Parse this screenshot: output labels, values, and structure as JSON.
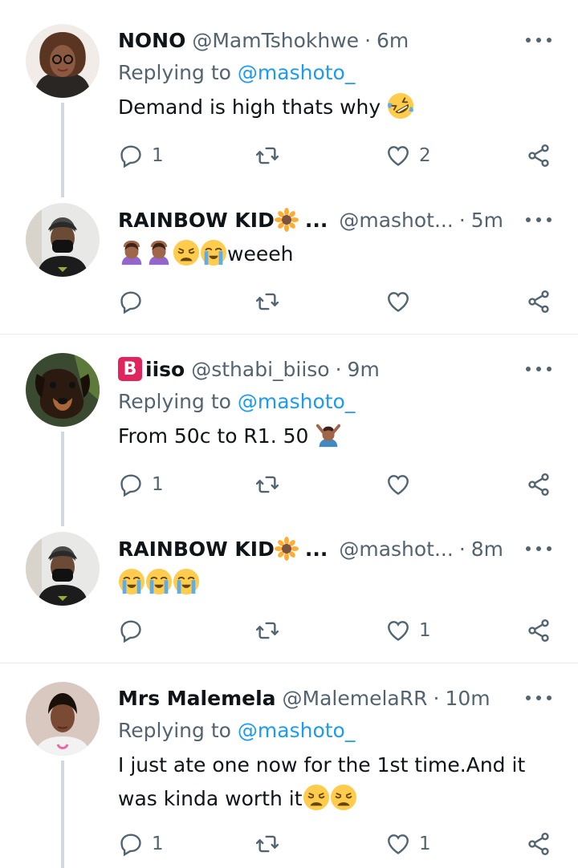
{
  "tweets": [
    {
      "name": "NONO",
      "handle": "@MamTshokhwe",
      "time": "6m",
      "replying_prefix": "Replying to",
      "replying_to": "@mashoto_",
      "text": "Demand is high thats why",
      "emojis": [
        "rofl-emoji"
      ],
      "reply_count": "1",
      "retweet_count": "",
      "like_count": "2"
    },
    {
      "name": "RAINBOW KID",
      "name_suffix": "...",
      "handle": "@mashot...",
      "time": "5m",
      "text": "weeeh",
      "emojis": [
        "facepalm-woman-emoji",
        "facepalm-woman-emoji",
        "weary-face-emoji",
        "loudly-crying-face-emoji"
      ],
      "reply_count": "",
      "retweet_count": "",
      "like_count": ""
    },
    {
      "name": "iiso",
      "name_badge": "B",
      "handle": "@sthabi_biiso",
      "time": "9m",
      "replying_prefix": "Replying to",
      "replying_to": "@mashoto_",
      "text": "From 50c to R1. 50",
      "emojis": [
        "man-gesturing-no-emoji"
      ],
      "reply_count": "1",
      "retweet_count": "",
      "like_count": ""
    },
    {
      "name": "RAINBOW KID",
      "name_suffix": "...",
      "handle": "@mashot...",
      "time": "8m",
      "text": "",
      "emojis": [
        "loudly-crying-face-emoji",
        "loudly-crying-face-emoji",
        "loudly-crying-face-emoji"
      ],
      "reply_count": "",
      "retweet_count": "",
      "like_count": "1"
    },
    {
      "name": "Mrs Malemela",
      "handle": "@MalemelaRR",
      "time": "10m",
      "replying_prefix": "Replying to",
      "replying_to": "@mashoto_",
      "text_line1": "I just ate one now for the 1st time.And it",
      "text_line2": "was kinda worth it",
      "emojis": [
        "weary-face-emoji",
        "weary-face-emoji"
      ],
      "reply_count": "1",
      "retweet_count": "",
      "like_count": "1"
    }
  ],
  "separator": "·",
  "icons": {
    "reply": "reply-icon",
    "retweet": "retweet-icon",
    "like": "heart-icon",
    "share": "share-icon",
    "more": "more-options-icon"
  },
  "colors": {
    "accent": "#1d9bf0",
    "muted": "#536471",
    "thread_line": "#cfd9de",
    "badge": "#e0245e"
  }
}
